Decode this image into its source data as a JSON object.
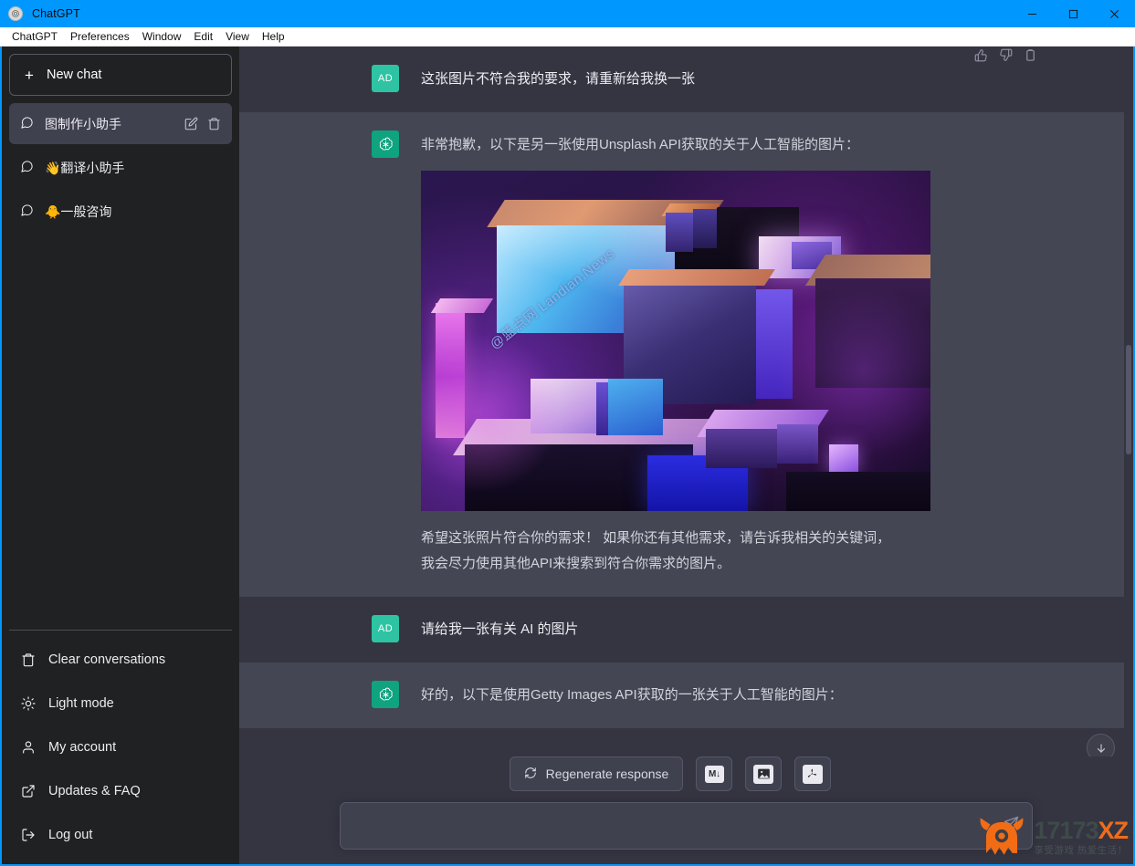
{
  "window": {
    "title": "ChatGPT",
    "logo_icon": "chatgpt-logo",
    "controls": {
      "minimize": "─",
      "maximize": "☐",
      "close": "✕"
    }
  },
  "menubar": {
    "items": [
      {
        "label": "ChatGPT"
      },
      {
        "label": "Preferences"
      },
      {
        "label": "Window"
      },
      {
        "label": "Edit"
      },
      {
        "label": "View"
      },
      {
        "label": "Help"
      }
    ]
  },
  "sidebar": {
    "new_chat_label": "New chat",
    "new_chat_icon": "plus-icon",
    "chats": [
      {
        "label": "图制作小助手",
        "icon": "chat-bubble-icon",
        "active": true
      },
      {
        "label": "👋翻译小助手",
        "icon": "chat-bubble-icon",
        "active": false
      },
      {
        "label": "🐥一般咨询",
        "icon": "chat-bubble-icon",
        "active": false
      }
    ],
    "item_actions": {
      "edit": "pencil-icon",
      "delete": "trash-icon"
    },
    "bottom_items": [
      {
        "label": "Clear conversations",
        "icon": "trash-icon"
      },
      {
        "label": "Light mode",
        "icon": "sun-icon"
      },
      {
        "label": "My account",
        "icon": "person-icon"
      },
      {
        "label": "Updates & FAQ",
        "icon": "external-link-icon"
      },
      {
        "label": "Log out",
        "icon": "logout-icon"
      }
    ]
  },
  "conversation": {
    "user_avatar_initials": "AD",
    "messages": [
      {
        "role": "user",
        "text": "这张图片不符合我的要求，请重新给我换一张"
      },
      {
        "role": "assistant",
        "text": "非常抱歉，以下是另一张使用Unsplash API获取的关于人工智能的图片：",
        "image_watermark": "@蓝点网 Landian.News",
        "footer_line1": "希望这张照片符合你的需求！ 如果你还有其他需求，请告诉我相关的关键词，",
        "footer_line2": "我会尽力使用其他API来搜索到符合你需求的图片。"
      },
      {
        "role": "user",
        "text": "请给我一张有关 AI 的图片"
      },
      {
        "role": "assistant",
        "text": "好的，以下是使用Getty Images API获取的一张关于人工智能的图片："
      }
    ],
    "actions": {
      "thumbs_up": "thumbs-up-icon",
      "thumbs_down": "thumbs-down-icon",
      "copy": "copy-icon"
    }
  },
  "composer": {
    "regenerate_label": "Regenerate response",
    "regenerate_icon": "refresh-icon",
    "export_buttons": [
      {
        "name": "markdown",
        "glyph": "M↓"
      },
      {
        "name": "image",
        "glyph": "image-icon"
      },
      {
        "name": "pdf",
        "glyph": "pdf-icon"
      }
    ],
    "input_value": "",
    "input_placeholder": "",
    "send_icon": "send-icon",
    "scroll_bottom_icon": "arrow-down-icon"
  },
  "watermark": {
    "brand_primary": "17173",
    "brand_accent": "XZ",
    "tagline": "享受游戏 热爱生活！",
    "accent_color": "#ef6c1a"
  }
}
